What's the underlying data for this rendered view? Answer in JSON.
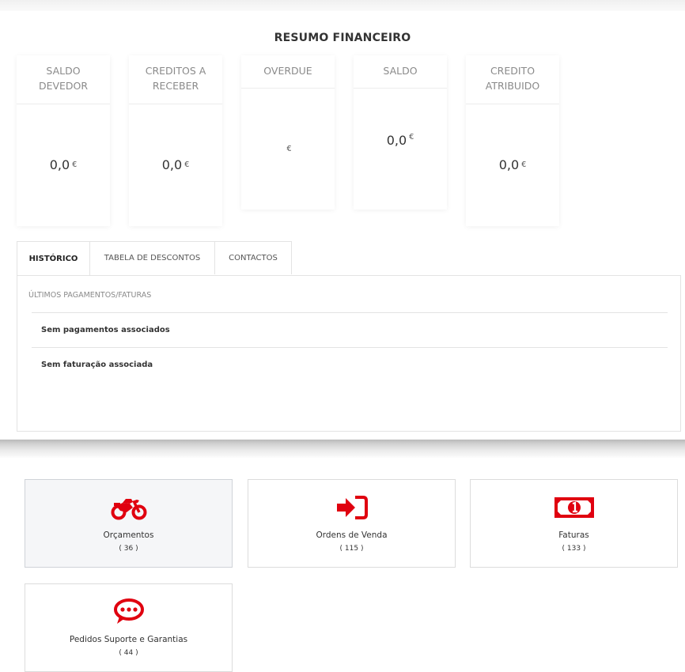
{
  "summary": {
    "title": "RESUMO FINANCEIRO",
    "currency_symbol": "€",
    "cards": [
      {
        "label": "SALDO DEVEDOR",
        "value": "0,0"
      },
      {
        "label": "CREDITOS A RECEBER",
        "value": "0,0"
      },
      {
        "label": "OVERDUE",
        "value": ""
      },
      {
        "label": "SALDO",
        "value": "0,0"
      },
      {
        "label": "CREDITO ATRIBUIDO",
        "value": "0,0"
      }
    ]
  },
  "tabs": [
    {
      "label": "HISTÓRICO",
      "active": true
    },
    {
      "label": "TABELA DE DESCONTOS",
      "active": false
    },
    {
      "label": "CONTACTOS",
      "active": false
    }
  ],
  "history": {
    "section_label": "ÚLTIMOS PAGAMENTOS/FATURAS",
    "rows": [
      "Sem pagamentos associados",
      "Sem faturação associada"
    ]
  },
  "tiles": [
    {
      "label": "Orçamentos",
      "count": "( 36 )",
      "icon": "motorcycle-icon"
    },
    {
      "label": "Ordens de Venda",
      "count": "( 115 )",
      "icon": "sign-in-icon"
    },
    {
      "label": "Faturas",
      "count": "( 133 )",
      "icon": "money-icon"
    },
    {
      "label": "Pedidos Suporte e Garantias",
      "count": "( 44 )",
      "icon": "chat-bubble-icon"
    }
  ],
  "colors": {
    "accent": "#e0000f",
    "muted_text": "#8a8a8a",
    "border": "#e3e3e3"
  }
}
